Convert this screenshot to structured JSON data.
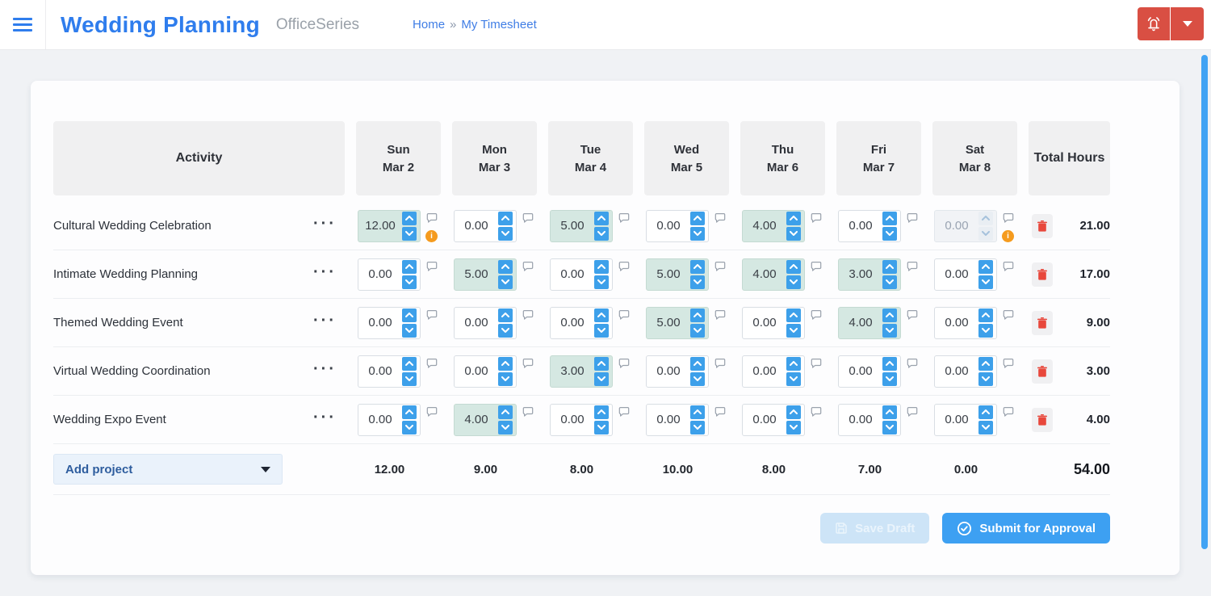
{
  "header": {
    "title": "Wedding Planning",
    "brand": "OfficeSeries",
    "breadcrumb": {
      "home": "Home",
      "separator": "»",
      "current": "My Timesheet"
    }
  },
  "icons": {
    "menu": "hamburger-icon",
    "notifications": "bell-icon",
    "account": "caret-down-icon",
    "row_menu": "ellipsis-icon",
    "comment": "speech-bubble-icon",
    "warning": "info-icon",
    "delete": "trash-icon",
    "save": "floppy-disk-icon",
    "submit": "check-circle-icon"
  },
  "colors": {
    "title_blue": "#2f7ded",
    "accent_blue": "#3da0f2",
    "spinner_blue": "#3da0ea",
    "alert_red": "#d94f43",
    "highlight_teal": "#d5e8e2",
    "warning_orange": "#f59b1e",
    "scrollbar_blue": "#41a3f4"
  },
  "timesheet": {
    "columns": {
      "activity": "Activity",
      "days": [
        {
          "day": "Sun",
          "date": "Mar 2"
        },
        {
          "day": "Mon",
          "date": "Mar 3"
        },
        {
          "day": "Tue",
          "date": "Mar 4"
        },
        {
          "day": "Wed",
          "date": "Mar 5"
        },
        {
          "day": "Thu",
          "date": "Mar 6"
        },
        {
          "day": "Fri",
          "date": "Mar 7"
        },
        {
          "day": "Sat",
          "date": "Mar 8"
        }
      ],
      "total": "Total Hours"
    },
    "row_menu_glyph": "···",
    "rows": [
      {
        "activity": "Cultural Wedding Celebration",
        "cells": [
          {
            "value": "12.00",
            "highlighted": true,
            "disabled": false,
            "info": true
          },
          {
            "value": "0.00",
            "highlighted": false,
            "disabled": false,
            "info": false
          },
          {
            "value": "5.00",
            "highlighted": true,
            "disabled": false,
            "info": false
          },
          {
            "value": "0.00",
            "highlighted": false,
            "disabled": false,
            "info": false
          },
          {
            "value": "4.00",
            "highlighted": true,
            "disabled": false,
            "info": false
          },
          {
            "value": "0.00",
            "highlighted": false,
            "disabled": false,
            "info": false
          },
          {
            "value": "0.00",
            "highlighted": false,
            "disabled": true,
            "info": true
          }
        ],
        "total": "21.00"
      },
      {
        "activity": "Intimate Wedding Planning",
        "cells": [
          {
            "value": "0.00",
            "highlighted": false,
            "disabled": false,
            "info": false
          },
          {
            "value": "5.00",
            "highlighted": true,
            "disabled": false,
            "info": false
          },
          {
            "value": "0.00",
            "highlighted": false,
            "disabled": false,
            "info": false
          },
          {
            "value": "5.00",
            "highlighted": true,
            "disabled": false,
            "info": false
          },
          {
            "value": "4.00",
            "highlighted": true,
            "disabled": false,
            "info": false
          },
          {
            "value": "3.00",
            "highlighted": true,
            "disabled": false,
            "info": false
          },
          {
            "value": "0.00",
            "highlighted": false,
            "disabled": false,
            "info": false
          }
        ],
        "total": "17.00"
      },
      {
        "activity": "Themed Wedding Event",
        "cells": [
          {
            "value": "0.00",
            "highlighted": false,
            "disabled": false,
            "info": false
          },
          {
            "value": "0.00",
            "highlighted": false,
            "disabled": false,
            "info": false
          },
          {
            "value": "0.00",
            "highlighted": false,
            "disabled": false,
            "info": false
          },
          {
            "value": "5.00",
            "highlighted": true,
            "disabled": false,
            "info": false
          },
          {
            "value": "0.00",
            "highlighted": false,
            "disabled": false,
            "info": false
          },
          {
            "value": "4.00",
            "highlighted": true,
            "disabled": false,
            "info": false
          },
          {
            "value": "0.00",
            "highlighted": false,
            "disabled": false,
            "info": false
          }
        ],
        "total": "9.00"
      },
      {
        "activity": "Virtual Wedding Coordination",
        "cells": [
          {
            "value": "0.00",
            "highlighted": false,
            "disabled": false,
            "info": false
          },
          {
            "value": "0.00",
            "highlighted": false,
            "disabled": false,
            "info": false
          },
          {
            "value": "3.00",
            "highlighted": true,
            "disabled": false,
            "info": false
          },
          {
            "value": "0.00",
            "highlighted": false,
            "disabled": false,
            "info": false
          },
          {
            "value": "0.00",
            "highlighted": false,
            "disabled": false,
            "info": false
          },
          {
            "value": "0.00",
            "highlighted": false,
            "disabled": false,
            "info": false
          },
          {
            "value": "0.00",
            "highlighted": false,
            "disabled": false,
            "info": false
          }
        ],
        "total": "3.00"
      },
      {
        "activity": "Wedding Expo Event",
        "cells": [
          {
            "value": "0.00",
            "highlighted": false,
            "disabled": false,
            "info": false
          },
          {
            "value": "4.00",
            "highlighted": true,
            "disabled": false,
            "info": false
          },
          {
            "value": "0.00",
            "highlighted": false,
            "disabled": false,
            "info": false
          },
          {
            "value": "0.00",
            "highlighted": false,
            "disabled": false,
            "info": false
          },
          {
            "value": "0.00",
            "highlighted": false,
            "disabled": false,
            "info": false
          },
          {
            "value": "0.00",
            "highlighted": false,
            "disabled": false,
            "info": false
          },
          {
            "value": "0.00",
            "highlighted": false,
            "disabled": false,
            "info": false
          }
        ],
        "total": "4.00"
      }
    ],
    "footer": {
      "add_project": "Add project",
      "day_totals": [
        "12.00",
        "9.00",
        "8.00",
        "10.00",
        "8.00",
        "7.00",
        "0.00"
      ],
      "grand_total": "54.00"
    },
    "actions": {
      "save_draft": "Save Draft",
      "submit": "Submit for Approval"
    }
  }
}
